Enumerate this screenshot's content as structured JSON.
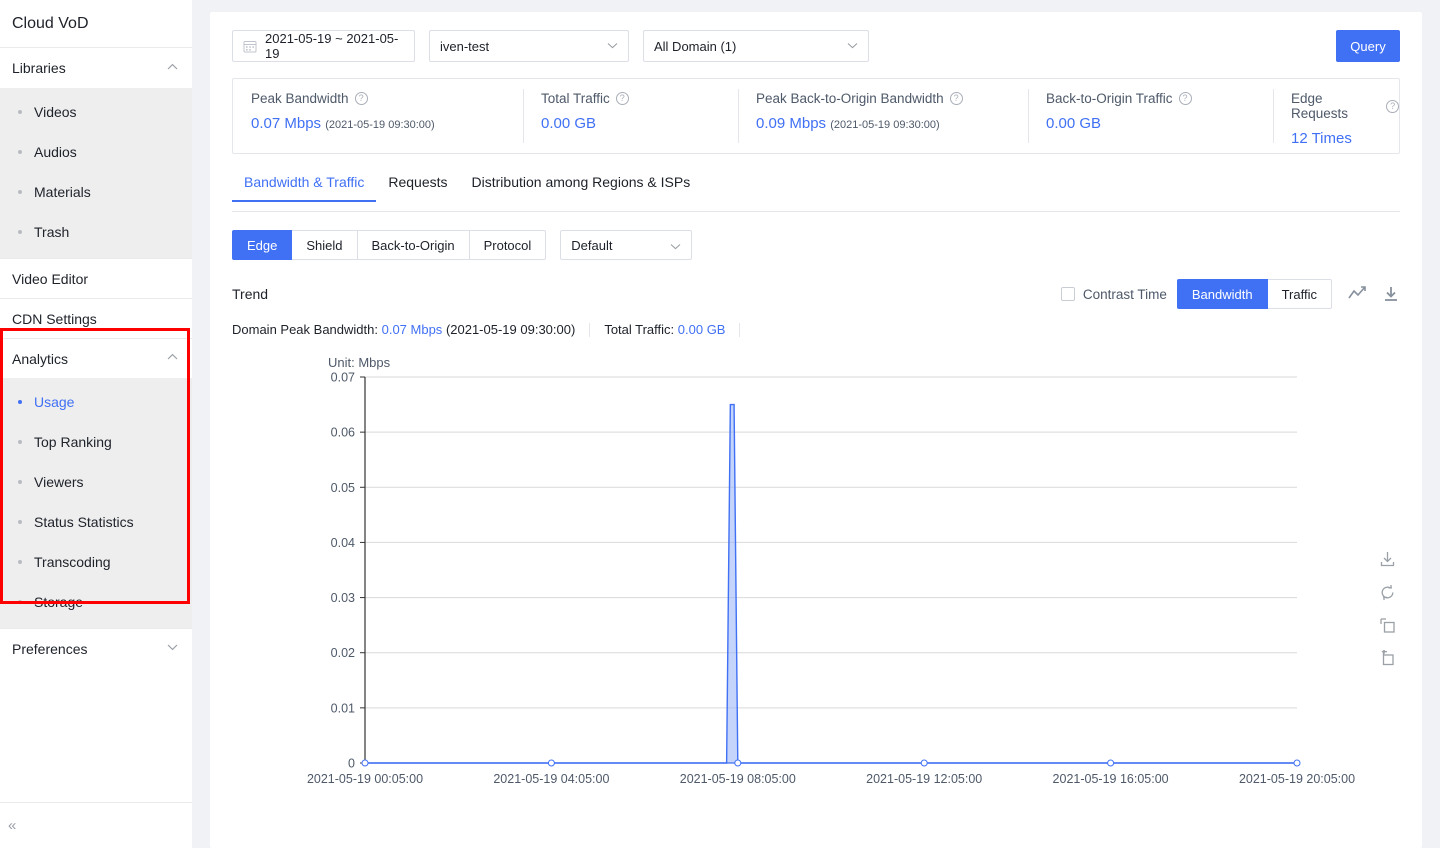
{
  "brand": {
    "title": "Cloud VoD"
  },
  "sidebar": {
    "groups": [
      {
        "label": "Libraries",
        "icon": "chevron-up-icon",
        "expanded": true,
        "items": [
          {
            "label": "Videos",
            "active": false
          },
          {
            "label": "Audios",
            "active": false
          },
          {
            "label": "Materials",
            "active": false
          },
          {
            "label": "Trash",
            "active": false
          }
        ]
      }
    ],
    "singles": [
      {
        "label": "Video Editor"
      },
      {
        "label": "CDN Settings"
      }
    ],
    "analytics": {
      "label": "Analytics",
      "icon": "chevron-up-icon",
      "expanded": true,
      "highlighted": true,
      "highlight_color": "#ff0000",
      "items": [
        {
          "label": "Usage",
          "active": true
        },
        {
          "label": "Top Ranking",
          "active": false
        },
        {
          "label": "Viewers",
          "active": false
        },
        {
          "label": "Status Statistics",
          "active": false
        },
        {
          "label": "Transcoding",
          "active": false
        },
        {
          "label": "Storage",
          "active": false
        }
      ]
    },
    "preferences": {
      "label": "Preferences",
      "icon": "chevron-down-icon",
      "expanded": false
    },
    "collapse": {
      "icon": "collapse-left-icon",
      "glyph": "«"
    }
  },
  "filters": {
    "date_range": {
      "value": "2021-05-19 ~ 2021-05-19",
      "icon": "calendar-icon"
    },
    "app_select": {
      "value": "iven-test",
      "icon": "chevron-down-icon"
    },
    "domain_select": {
      "value": "All Domain (1)",
      "icon": "chevron-down-icon"
    },
    "query_button": "Query"
  },
  "metrics": [
    {
      "label": "Peak Bandwidth",
      "value": "0.07 Mbps",
      "timestamp": "(2021-05-19 09:30:00)",
      "help": "help-icon"
    },
    {
      "label": "Total Traffic",
      "value": "0.00 GB",
      "timestamp": "",
      "help": "help-icon"
    },
    {
      "label": "Peak Back-to-Origin Bandwidth",
      "value": "0.09 Mbps",
      "timestamp": "(2021-05-19 09:30:00)",
      "help": "help-icon"
    },
    {
      "label": "Back-to-Origin Traffic",
      "value": "0.00 GB",
      "timestamp": "",
      "help": "help-icon"
    },
    {
      "label": "Edge Requests",
      "value": "12 Times",
      "timestamp": "",
      "help": "help-icon"
    }
  ],
  "tabs": [
    {
      "label": "Bandwidth & Traffic",
      "active": true
    },
    {
      "label": "Requests",
      "active": false
    },
    {
      "label": "Distribution among Regions & ISPs",
      "active": false
    }
  ],
  "segments": [
    {
      "label": "Edge",
      "active": true
    },
    {
      "label": "Shield",
      "active": false
    },
    {
      "label": "Back-to-Origin",
      "active": false
    },
    {
      "label": "Protocol",
      "active": false
    }
  ],
  "default_select": {
    "value": "Default",
    "icon": "chevron-down-icon"
  },
  "trend": {
    "title": "Trend",
    "contrast_time": {
      "label": "Contrast Time",
      "checked": false
    },
    "metric_toggle": [
      {
        "label": "Bandwidth",
        "active": true
      },
      {
        "label": "Traffic",
        "active": false
      }
    ],
    "tools": [
      {
        "name": "line-chart-icon"
      },
      {
        "name": "download-icon"
      }
    ],
    "summary": {
      "peak_label": "Domain Peak Bandwidth:",
      "peak_value": "0.07 Mbps",
      "peak_time": "(2021-05-19 09:30:00)",
      "traffic_label": "Total Traffic:",
      "traffic_value": "0.00 GB"
    }
  },
  "chart_toolbox": [
    {
      "name": "save-image-icon"
    },
    {
      "name": "restore-icon"
    },
    {
      "name": "data-zoom-icon"
    },
    {
      "name": "data-zoom-reset-icon"
    }
  ],
  "chart_data": {
    "type": "line",
    "title": "Trend",
    "unit_label": "Unit: Mbps",
    "xlabel": "",
    "ylabel": "Mbps",
    "ylim": [
      0,
      0.07
    ],
    "yticks": [
      "0",
      "0.01",
      "0.02",
      "0.03",
      "0.04",
      "0.05",
      "0.06",
      "0.07"
    ],
    "ytick_values": [
      0,
      0.01,
      0.02,
      0.03,
      0.04,
      0.05,
      0.06,
      0.07
    ],
    "xticks": [
      "2021-05-19 00:05:00",
      "2021-05-19 04:05:00",
      "2021-05-19 08:05:00",
      "2021-05-19 12:05:00",
      "2021-05-19 16:05:00",
      "2021-05-19 20:05:00"
    ],
    "xtick_positions": [
      0,
      0.2,
      0.4,
      0.6,
      0.8,
      1.0
    ],
    "grid": true,
    "legend": "none",
    "line_color": "#4070f4",
    "area_color": "#93b0f8",
    "series": [
      {
        "name": "Bandwidth",
        "color": "#4070f4",
        "values": [
          {
            "x": 0.0,
            "y": 0
          },
          {
            "x": 0.36,
            "y": 0
          },
          {
            "x": 0.388,
            "y": 0
          },
          {
            "x": 0.392,
            "y": 0.065
          },
          {
            "x": 0.396,
            "y": 0.065
          },
          {
            "x": 0.4,
            "y": 0
          },
          {
            "x": 0.6,
            "y": 0
          },
          {
            "x": 1.0,
            "y": 0
          }
        ]
      }
    ]
  }
}
